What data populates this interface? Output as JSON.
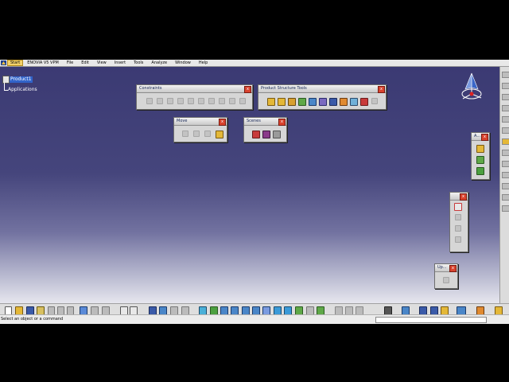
{
  "menubar": {
    "items": [
      "Start",
      "ENOVIA V5 VPM",
      "File",
      "Edit",
      "View",
      "Insert",
      "Tools",
      "Analyze",
      "Window",
      "Help"
    ]
  },
  "tree": {
    "root": "Product1",
    "child": "Applications"
  },
  "toolbars": {
    "constraints": {
      "title": "Constraints",
      "close": "x"
    },
    "product_structure_tools": {
      "title": "Product Structure Tools",
      "close": "x"
    },
    "move": {
      "title": "Move",
      "close": "x"
    },
    "scenes": {
      "title": "Scenes",
      "close": "x"
    },
    "a": {
      "title": "A...",
      "close": "x"
    },
    "unnamed": {
      "close": "x"
    },
    "up": {
      "title": "Up...",
      "close": "x"
    }
  },
  "statusbar": {
    "message": "Select an object or a command"
  },
  "colors": {
    "background_top": "#3b3a73",
    "background_bottom": "#e6e6ee",
    "selection": "#3163c9",
    "close_button": "#d9432e"
  }
}
